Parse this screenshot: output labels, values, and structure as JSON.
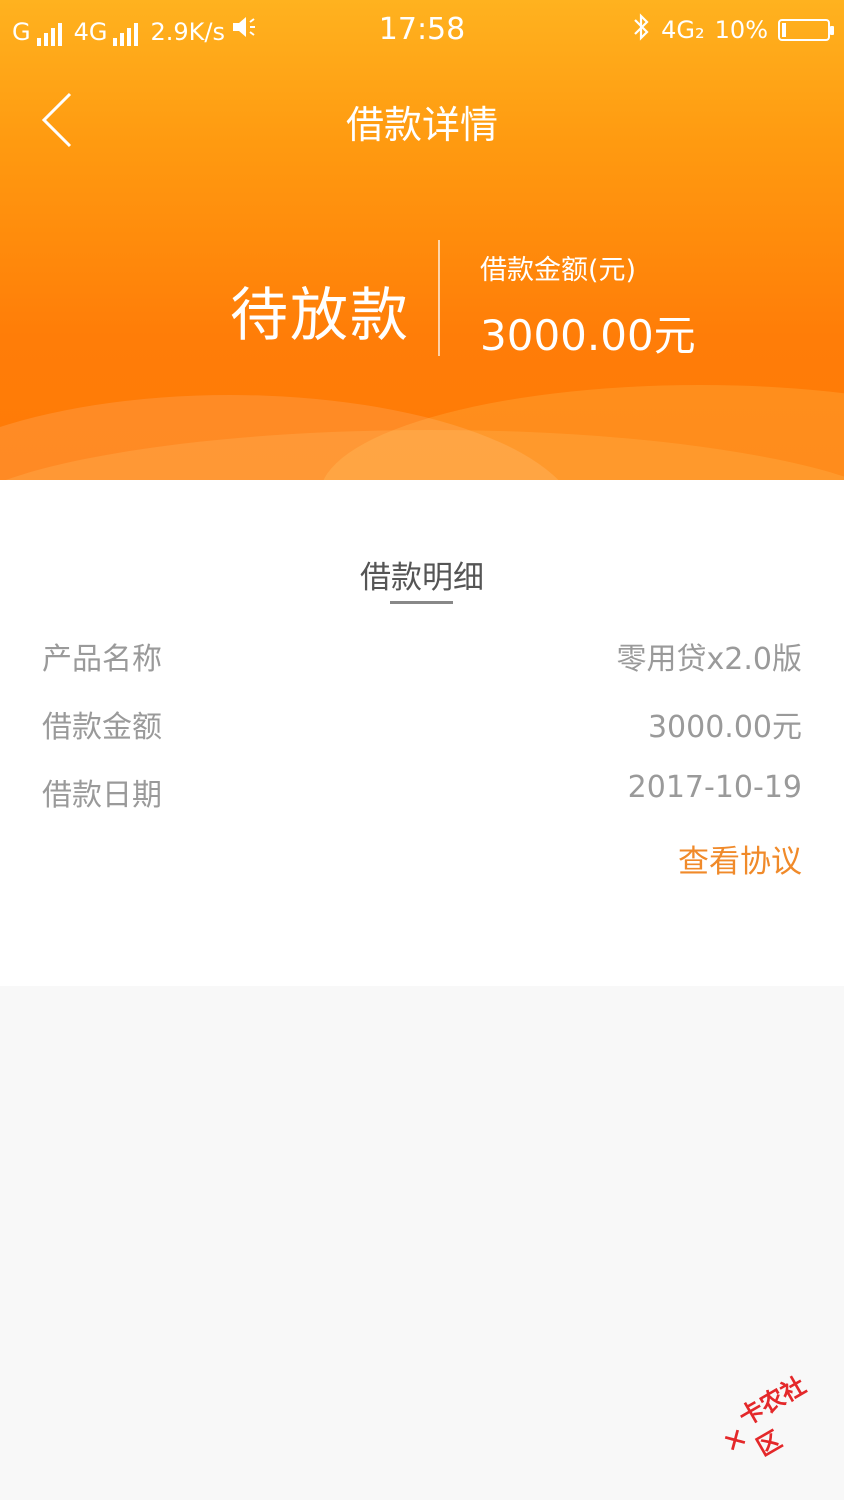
{
  "status_bar": {
    "carrier1": "G",
    "carrier2": "4G",
    "speed": "2.9K/s",
    "time": "17:58",
    "network": "4G₂",
    "battery": "10%",
    "battery_level": 0.1
  },
  "nav": {
    "title": "借款详情"
  },
  "summary": {
    "status": "待放款",
    "amount_label": "借款金额(元)",
    "amount_value": "3000.00元"
  },
  "details": {
    "section_title": "借款明细",
    "rows": [
      {
        "label": "产品名称",
        "value": "零用贷x2.0版"
      },
      {
        "label": "借款金额",
        "value": "3000.00元"
      },
      {
        "label": "借款日期",
        "value": "2017-10-19"
      }
    ],
    "agreement_link": "查看协议"
  },
  "watermark": {
    "text": "卡农社区"
  },
  "colors": {
    "accent": "#ff8a0f",
    "link": "#f08a2a"
  }
}
